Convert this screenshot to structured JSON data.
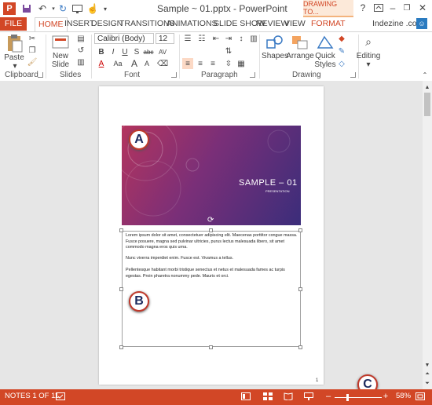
{
  "titlebar": {
    "title": "Sample ~ 01.pptx - PowerPoint",
    "contextual_tab": "DRAWING TO...",
    "help": "?",
    "minimize": "–",
    "restore": "❐",
    "close": "✕"
  },
  "tabs": {
    "file": "FILE",
    "home": "HOME",
    "insert": "INSERT",
    "design": "DESIGN",
    "transitions": "TRANSITIONS",
    "animations": "ANIMATIONS",
    "slideshow": "SLIDE SHOW",
    "review": "REVIEW",
    "view": "VIEW",
    "format": "FORMAT",
    "account": "Indezine .com"
  },
  "ribbon": {
    "clipboard": {
      "paste": "Paste",
      "label": "Clipboard"
    },
    "slides": {
      "new_slide_line1": "New",
      "new_slide_line2": "Slide",
      "label": "Slides"
    },
    "font": {
      "family": "Calibri (Body)",
      "size": "12",
      "label": "Font",
      "bold": "B",
      "italic": "I",
      "underline": "U",
      "strike": "S",
      "abc": "abc",
      "av": "AV",
      "aa": "Aa",
      "font_color": "A",
      "grow": "A",
      "shrink": "A"
    },
    "paragraph": {
      "label": "Paragraph"
    },
    "drawing": {
      "shapes": "Shapes",
      "arrange": "Arrange",
      "quick_styles_line1": "Quick",
      "quick_styles_line2": "Styles",
      "label": "Drawing"
    },
    "editing": {
      "label": "Editing"
    }
  },
  "slide": {
    "title": "SAMPLE – 01",
    "subtitle": "PRESENTATION"
  },
  "notes": {
    "paragraphs": [
      "Lorem ipsum dolor sit amet, consectetuer adipiscing elit. Maecenas porttitor congue massa. Fusce posuere, magna sed pulvinar ultricies, purus lectus malesuada libero, sit amet commodo magna eros quis urna.",
      "Nunc viverra imperdiet enim. Fusce est. Vivamus a tellus.",
      "Pellentesque habitant morbi tristique senectus et netus et malesuada fames ac turpis egestas. Proin pharetra nonummy pede. Mauris et orci."
    ],
    "page_number": "1"
  },
  "callouts": {
    "a": "A",
    "b": "B",
    "c": "C"
  },
  "status": {
    "page_info": "NOTES 1 OF 11",
    "zoom": "58%",
    "zoom_percent": 58
  },
  "colors": {
    "accent": "#d24726"
  }
}
